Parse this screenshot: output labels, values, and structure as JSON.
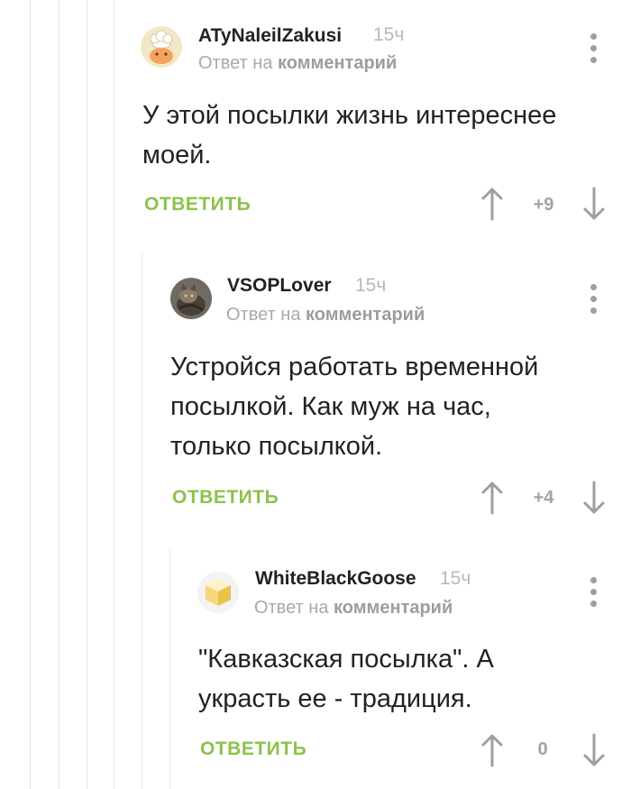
{
  "comments": [
    {
      "author": "ATyNaleilZakusi",
      "time": "15ч",
      "reply_prefix": "Ответ на",
      "reply_link": "комментарий",
      "body_lines": [
        "У этой посылки жизнь интереснее",
        "моей."
      ],
      "reply_label": "ОТВЕТИТЬ",
      "rating": "+9",
      "avatar": "chef-avatar"
    },
    {
      "author": "VSOPLover",
      "time": "15ч",
      "reply_prefix": "Ответ на",
      "reply_link": "комментарий",
      "body_lines": [
        "Устройся работать временной",
        "посылкой. Как муж на час,",
        "только посылкой."
      ],
      "reply_label": "ОТВЕТИТЬ",
      "rating": "+4",
      "avatar": "cat-photo-avatar"
    },
    {
      "author": "WhiteBlackGoose",
      "time": "15ч",
      "reply_prefix": "Ответ на",
      "reply_link": "комментарий",
      "body_lines": [
        "\"Кавказская посылка\". А",
        "украсть ее - традиция."
      ],
      "reply_label": "ОТВЕТИТЬ",
      "rating": "0",
      "avatar": "cube-avatar"
    }
  ],
  "colors": {
    "reply_green": "#8bc34a",
    "thread_line": "#e4e4e4",
    "muted_text": "#a9a9a9"
  },
  "icons": [
    "more-vertical-icon",
    "arrow-up-icon",
    "arrow-down-icon"
  ]
}
